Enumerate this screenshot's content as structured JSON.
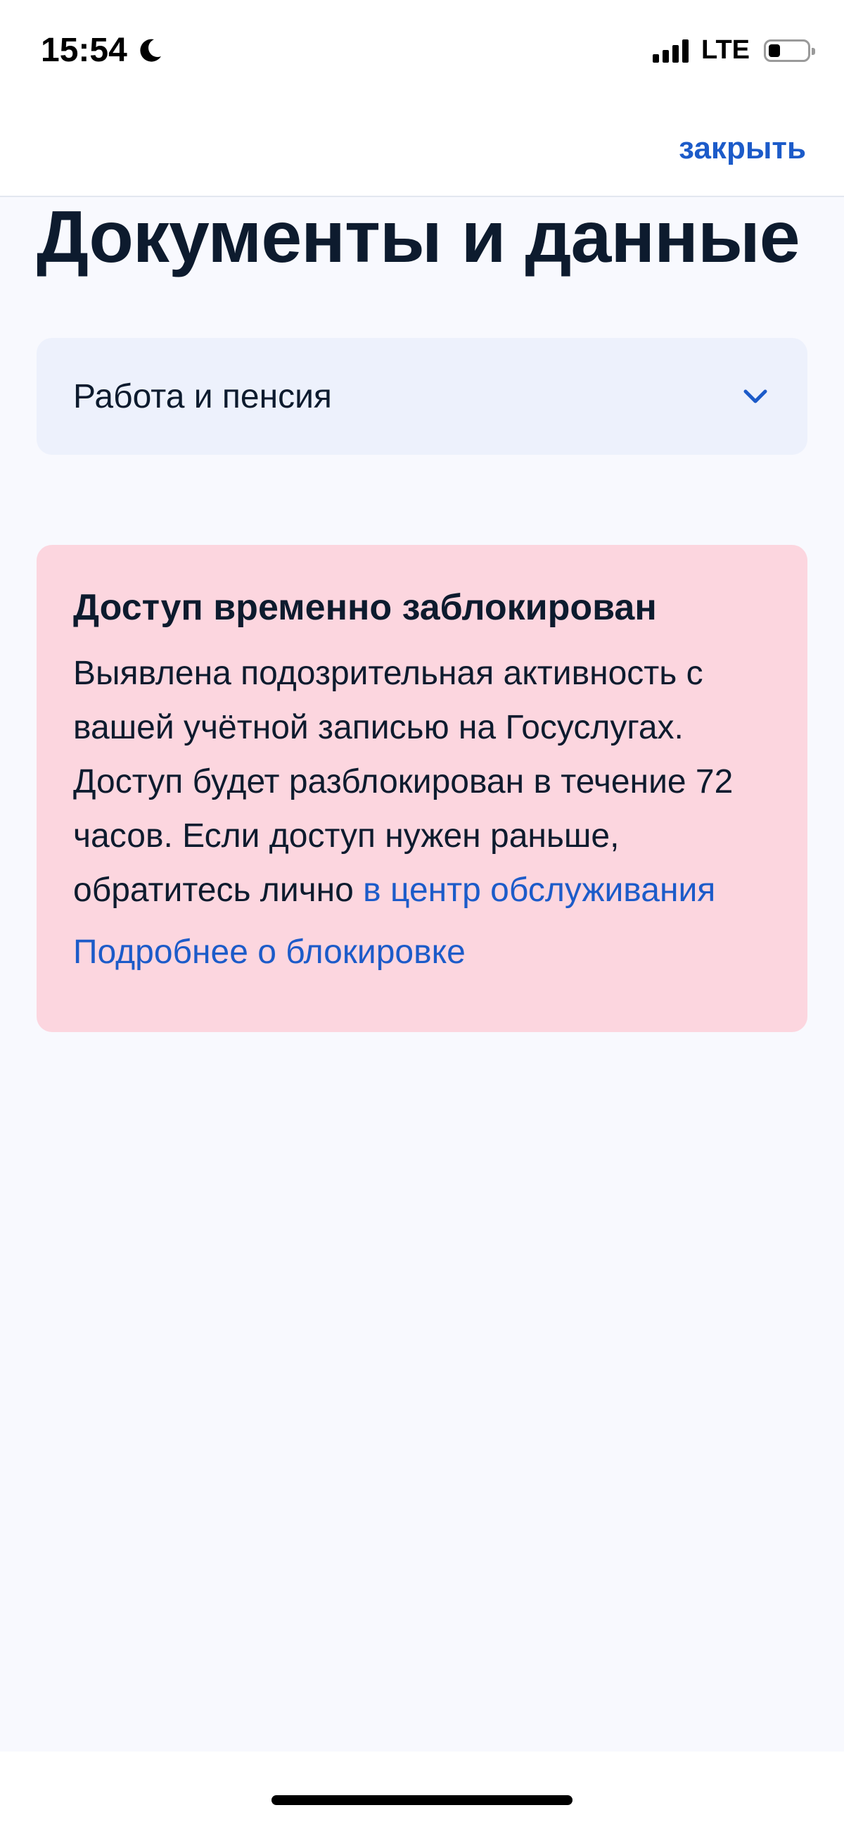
{
  "status_bar": {
    "time": "15:54",
    "network": "LTE",
    "battery_level_fraction": 0.3
  },
  "header": {
    "close_label": "закрыть"
  },
  "page": {
    "title": "Документы и данные"
  },
  "category_select": {
    "value": "Работа и пенсия"
  },
  "alert": {
    "title": "Доступ временно заблокирован",
    "body_text": "Выявлена подозрительная активность с вашей учётной записью на Госуслугах. Доступ будет разблокирован в течение 72 часов. Если доступ нужен раньше, обратитесь лично ",
    "service_center_link": "в центр обслуживания",
    "more_link": "Подробнее о блокировке"
  },
  "colors": {
    "accent_link": "#1c5bc9",
    "alert_background": "#fcd6df",
    "select_background": "#edf1fc",
    "page_background": "#f8f9fe",
    "text_primary": "#0d1b2e"
  },
  "icons": [
    "moon-icon",
    "signal-icon",
    "battery-icon",
    "chevron-down-icon"
  ]
}
